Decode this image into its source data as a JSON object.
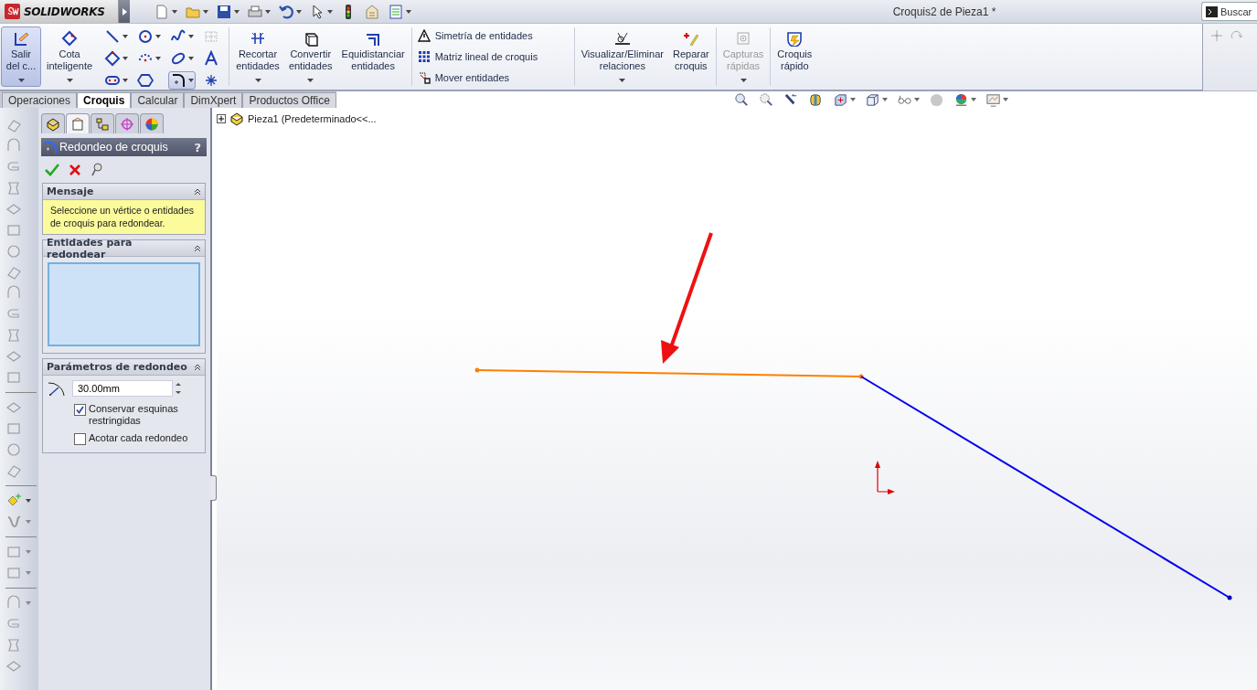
{
  "app": {
    "logo": "SOLIDWORKS",
    "title": "Croquis2 de Pieza1 *",
    "search": "Buscar"
  },
  "ribbon": [
    {
      "kind": "large",
      "label": "Salir\ndel c...",
      "selected": true,
      "dropdown": true,
      "disabled": false
    },
    {
      "kind": "large",
      "label": "Cota\ninteligente",
      "selected": false,
      "dropdown": true,
      "disabled": false
    },
    {
      "kind": "tools",
      "tools": [
        {
          "selected": false
        },
        {
          "selected": false
        },
        {
          "selected": false
        },
        {
          "selected": false
        },
        {
          "selected": false
        },
        {
          "selected": false
        },
        {
          "selected": false
        },
        {
          "selected": false
        },
        {
          "selected": false
        },
        {
          "selected": false
        },
        {
          "selected": true
        },
        {
          "selected": false
        }
      ]
    },
    {
      "kind": "large",
      "label": "Recortar\nentidades",
      "selected": false,
      "dropdown": true,
      "disabled": false
    },
    {
      "kind": "large",
      "label": "Convertir\nentidades",
      "selected": false,
      "dropdown": true,
      "disabled": false
    },
    {
      "kind": "large",
      "label": "Equidistanciar\nentidades",
      "selected": false,
      "dropdown": false,
      "disabled": false
    },
    {
      "kind": "list",
      "items": [
        "Simetría de entidades",
        "Matriz lineal de croquis",
        "Mover entidades"
      ]
    },
    {
      "kind": "large",
      "label": "Visualizar/Eliminar\nrelaciones",
      "selected": false,
      "dropdown": true,
      "disabled": false
    },
    {
      "kind": "large",
      "label": "Reparar\ncroquis",
      "selected": false,
      "dropdown": false,
      "disabled": false
    },
    {
      "kind": "large",
      "label": "Capturas\nrápidas",
      "selected": false,
      "dropdown": true,
      "disabled": true
    },
    {
      "kind": "large",
      "label": "Croquis\nrápido",
      "selected": false,
      "dropdown": false,
      "disabled": false
    }
  ],
  "tabs": [
    {
      "label": "Operaciones",
      "selected": false
    },
    {
      "label": "Croquis",
      "selected": true
    },
    {
      "label": "Calcular",
      "selected": false
    },
    {
      "label": "DimXpert",
      "selected": false
    },
    {
      "label": "Productos Office",
      "selected": false
    }
  ],
  "tree": {
    "label": "Pieza1  (Predeterminado<<..."
  },
  "panel_tabs": [
    {
      "selected": false
    },
    {
      "selected": true
    },
    {
      "selected": false
    },
    {
      "selected": false
    },
    {
      "selected": false
    }
  ],
  "property_manager": {
    "title": "Redondeo de croquis",
    "help": "?",
    "message": {
      "title": "Mensaje",
      "text": "Seleccione un vértice o entidades de croquis para redondear."
    },
    "entities": {
      "title": "Entidades para redondear"
    },
    "parameters": {
      "title": "Parámetros de redondeo",
      "radius": "30.00mm",
      "options": [
        {
          "label": "Conservar esquinas restringidas",
          "checked": true
        },
        {
          "label": "Acotar cada redondeo",
          "checked": false
        }
      ]
    }
  }
}
